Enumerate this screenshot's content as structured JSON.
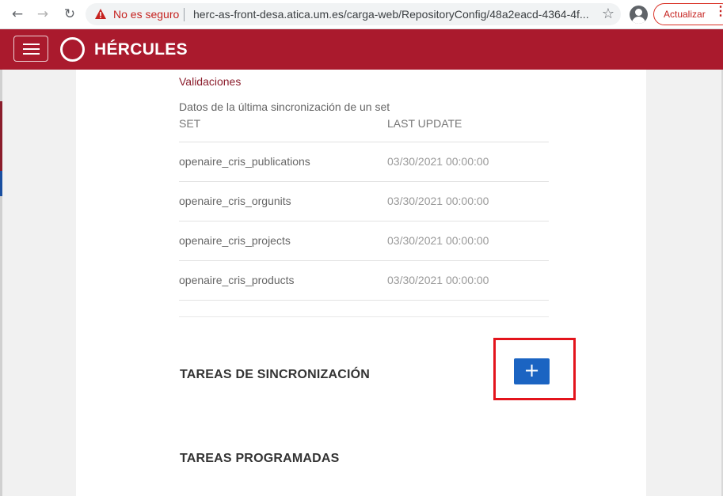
{
  "browser": {
    "back_icon": "arrow-left-icon",
    "forward_icon": "arrow-right-icon",
    "reload_icon": "reload-icon",
    "security_label": "No es seguro",
    "url": "herc-as-front-desa.atica.um.es/carga-web/RepositoryConfig/48a2eacd-4364-4f...",
    "update_label": "Actualizar",
    "accent_color": "#c5221f"
  },
  "header": {
    "brand": "HÉRCULES",
    "background_color": "#aa1a2d"
  },
  "config": {
    "validations_link": "Validaciones",
    "sync_caption": "Datos de la última sincronización de un set",
    "columns": [
      "SET",
      "LAST UPDATE"
    ],
    "rows": [
      {
        "set": "openaire_cris_publications",
        "last_update": "03/30/2021 00:00:00"
      },
      {
        "set": "openaire_cris_orgunits",
        "last_update": "03/30/2021 00:00:00"
      },
      {
        "set": "openaire_cris_projects",
        "last_update": "03/30/2021 00:00:00"
      },
      {
        "set": "openaire_cris_products",
        "last_update": "03/30/2021 00:00:00"
      }
    ]
  },
  "sync_tasks": {
    "title": "TAREAS DE SINCRONIZACIÓN",
    "add_label": "+",
    "button_color": "#1b64c2"
  },
  "scheduled_tasks": {
    "title": "TAREAS PROGRAMADAS"
  }
}
